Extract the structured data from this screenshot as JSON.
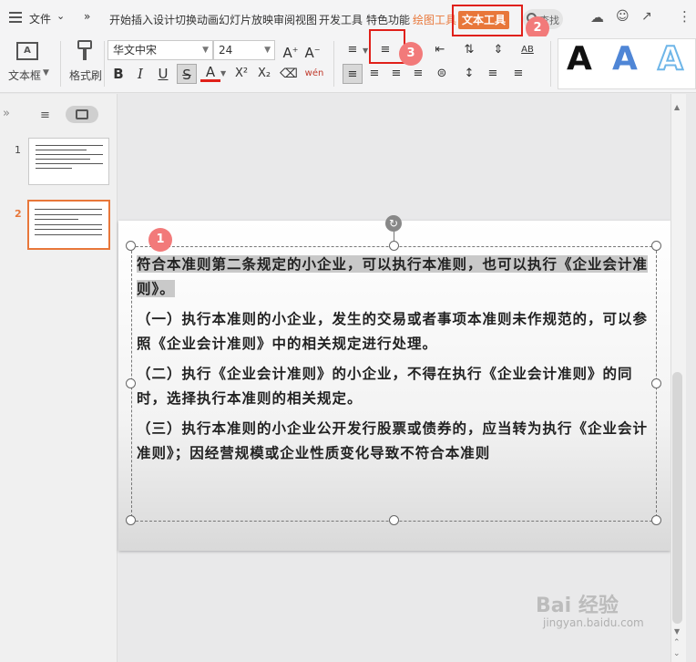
{
  "menubar": {
    "file_label": "文件",
    "tabs": [
      "开始",
      "插入",
      "设计",
      "切换",
      "动画",
      "幻灯片放映",
      "审阅",
      "视图",
      "开发工具",
      "特色功能"
    ],
    "tab_drawing_tool": "绘图工具",
    "tab_text_tool": "文本工具",
    "search_label": "查找"
  },
  "ribbon": {
    "textbox_label": "文本框",
    "format_painter_label": "格式刷",
    "font_name": "华文中宋",
    "font_size": "24",
    "bold": "B",
    "italic": "I",
    "underline": "U",
    "strikethrough": "S",
    "font_color": "A",
    "superscript": "X²",
    "subscript": "X₂",
    "phonetic": "wén",
    "text_style_preview": "A"
  },
  "badges": {
    "b1": "1",
    "b2": "2",
    "b3": "3"
  },
  "slides": {
    "n1": "1",
    "n2": "2"
  },
  "slide": {
    "para1": "符合本准则第二条规定的小企业，可以执行本准则，也可以执行《企业会计准则》。",
    "para2": "（一）执行本准则的小企业，发生的交易或者事项本准则未作规范的，可以参照《企业会计准则》中的相关规定进行处理。",
    "para3": "（二）执行《企业会计准则》的小企业，不得在执行《企业会计准则》的同时，选择执行本准则的相关规定。",
    "para4": "（三）执行本准则的小企业公开发行股票或债券的，应当转为执行《企业会计准则》；因经营规模或企业性质变化导致不符合本准则"
  },
  "watermark": {
    "brand": "Bai  经验",
    "site": "jingyan.baidu.com"
  },
  "colors": {
    "accent_orange": "#e8773a",
    "callout_red": "#e0201a",
    "badge_pink": "#f27a7a",
    "text_style_blue": "#4f86d6"
  }
}
